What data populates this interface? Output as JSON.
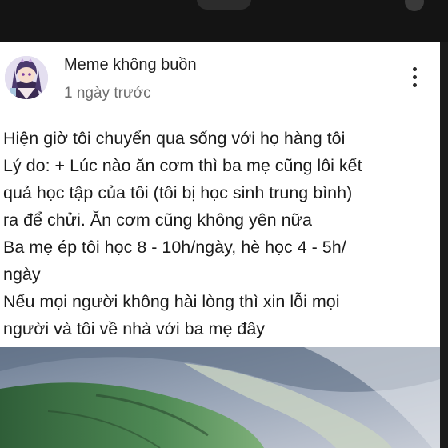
{
  "post": {
    "author": "Meme không buồn",
    "time": "1 ngày trước",
    "more_icon": "more-vertical-icon",
    "avatar_icon": "anime-girl-avatar",
    "lines": [
      "Hiện giờ tôi chuyển qua sống với họ hàng tôi",
      "Lý do: + Lúc nào ăn cơm thì ba mẹ cũng lôi kết",
      "quả học tập của tôi (tôi bị học sinh trung bình)",
      "ra để chửi. Ăn cơm cũng không yên nữa",
      "Ba mẹ ép tôi học 8 - 10h/ngày, hè học 4 - 5h/",
      "ngày",
      "Nếu mọi người không hài lòng thì xin lỗi mọi",
      "người và tôi về nhà với ba mẹ đây"
    ]
  },
  "colors": {
    "card_background": "#ffffff",
    "screen_background": "#141414",
    "text_primary": "#1b1b1b",
    "text_secondary": "#6e6e6e",
    "media_green": "#3f7a45"
  }
}
